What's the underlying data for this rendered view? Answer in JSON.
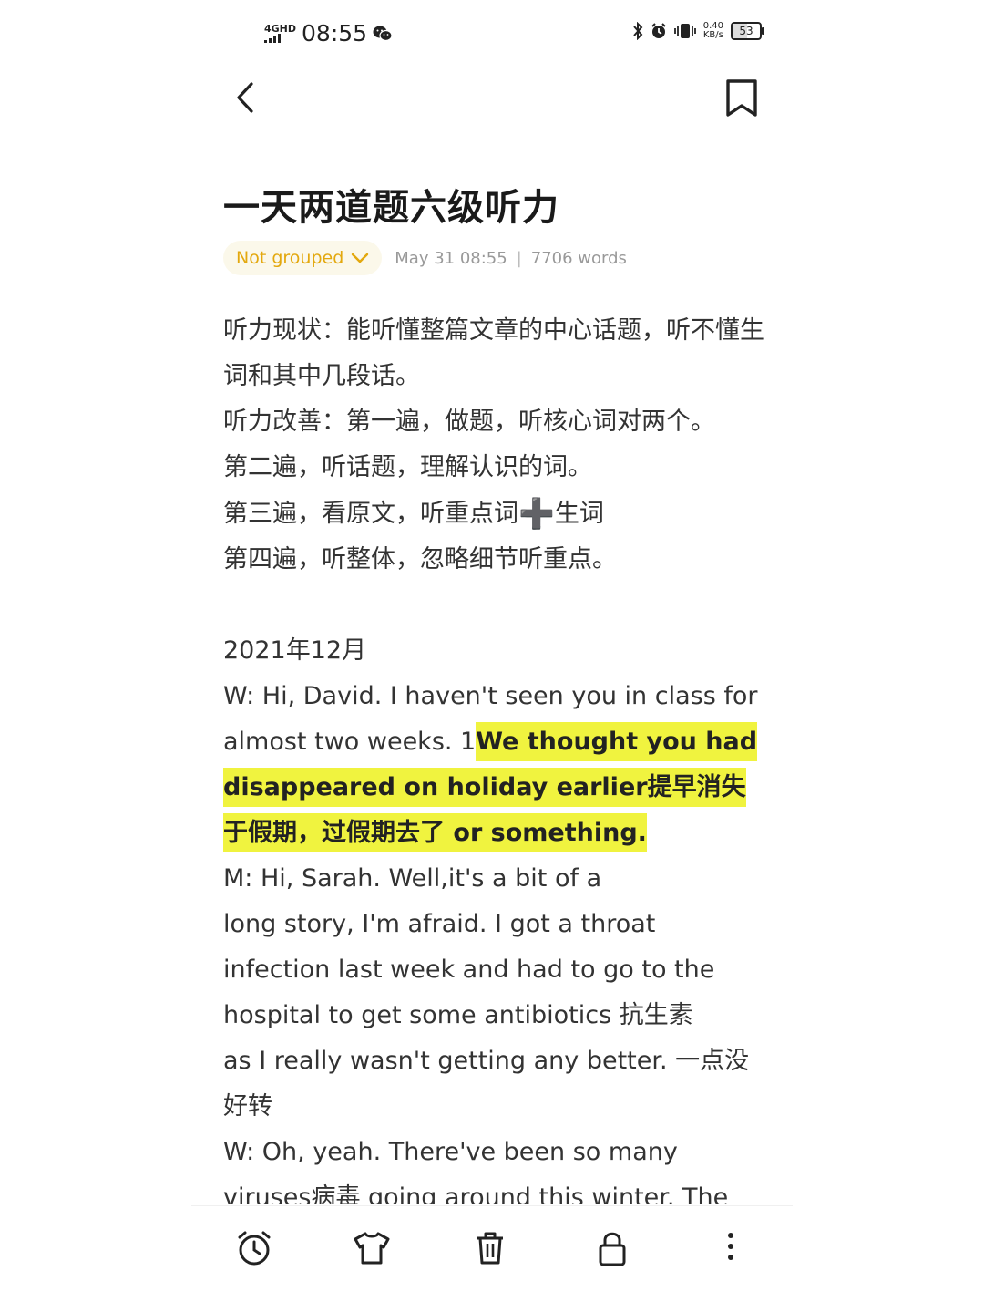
{
  "status_bar": {
    "network": "4GHD",
    "time": "08:55",
    "speed_value": "0.40",
    "speed_unit": "KB/s",
    "battery": "53",
    "battery_level": 0.53
  },
  "icons": {
    "back": "back-arrow-icon",
    "bookmark": "bookmark-icon",
    "alarm": "alarm-clock-icon",
    "theme": "t-shirt-icon",
    "delete": "trash-icon",
    "lock": "lock-icon",
    "more": "more-vertical-icon"
  },
  "note": {
    "title": "一天两道题六级听力",
    "group": "Not grouped",
    "date": "May 31 08:55",
    "separator": "|",
    "word_count": "7706 words"
  },
  "content": {
    "line1": "听力现状：能听懂整篇文章的中心话题，听不懂生词和其中几段话。",
    "line2": "听力改善：第一遍，做题，听核心词对两个。",
    "line3": "第二遍，听话题，理解认识的词。",
    "line4_a": "第三遍，看原文，听重点词",
    "line4_plus": "➕",
    "line4_b": "生词",
    "line5": "第四遍，听整体，忽略细节听重点。",
    "date_heading": "2021年12月",
    "w1_plain": "W: Hi, David. I haven't seen you in class for almost two weeks. 1",
    "w1_highlight": "We thought you had disappeared on holiday earlier提早消失于假期，过假期去了 or something.",
    "m1_l1": "M: Hi, Sarah. Well,it's a bit of a",
    "m1_l2": "long story, I'm afraid. I got a throat infection last week and had to go to the hospital to get some antibiotics 抗生素",
    "m1_l3": "as I really wasn't getting any better. 一点没好转",
    "w2": "W: Oh, yeah. There've been so many viruses病毒 going around this winter. The"
  },
  "colors": {
    "accent": "#e3a80e",
    "highlight": "#f0f33f",
    "chip_bg": "#fbf8ea"
  }
}
